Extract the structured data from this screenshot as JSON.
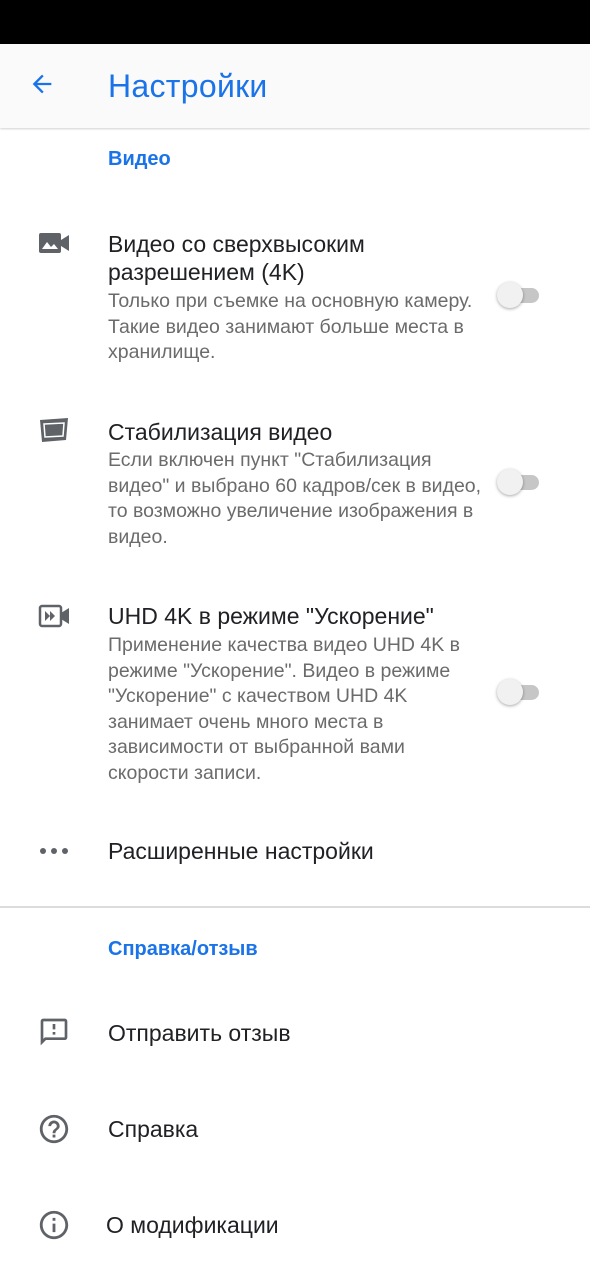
{
  "app_bar": {
    "title": "Настройки",
    "back_icon": "arrow-back-icon"
  },
  "sections": {
    "video": {
      "header": "Видео"
    },
    "help": {
      "header": "Справка/отзыв"
    }
  },
  "video_items": [
    {
      "icon": "image-camera-icon",
      "title": "Видео со сверхвысоким разрешением (4K)",
      "description": "Только при съемке на основную камеру. Такие видео занимают больше места в хранилище.",
      "toggle_on": false
    },
    {
      "icon": "stabilization-icon",
      "title": "Стабилизация видео",
      "description": "Если включен пункт \"Стабилизация видео\" и выбрано 60 кадров/сек в видео, то возможно увеличение изображения в видео.",
      "toggle_on": false
    },
    {
      "icon": "fast-forward-camera-icon",
      "title": "UHD 4K в режиме \"Ускорение\"",
      "description": "Применение качества видео UHD 4K в режиме \"Ускорение\". Видео в режиме \"Ускорение\" с качеством UHD 4K занимает очень много места в зависимости от выбранной вами скорости записи.",
      "toggle_on": false
    }
  ],
  "advanced": {
    "icon": "more-horiz-icon",
    "title": "Расширенные настройки"
  },
  "help_items": [
    {
      "icon": "feedback-icon",
      "title": "Отправить отзыв"
    },
    {
      "icon": "help-icon",
      "title": "Справка"
    },
    {
      "icon": "info-icon",
      "title": "О модификации"
    }
  ],
  "colors": {
    "accent": "#1a73e8",
    "text_primary": "#202124",
    "text_secondary": "#6b6b6b",
    "icon": "#5f6368"
  }
}
